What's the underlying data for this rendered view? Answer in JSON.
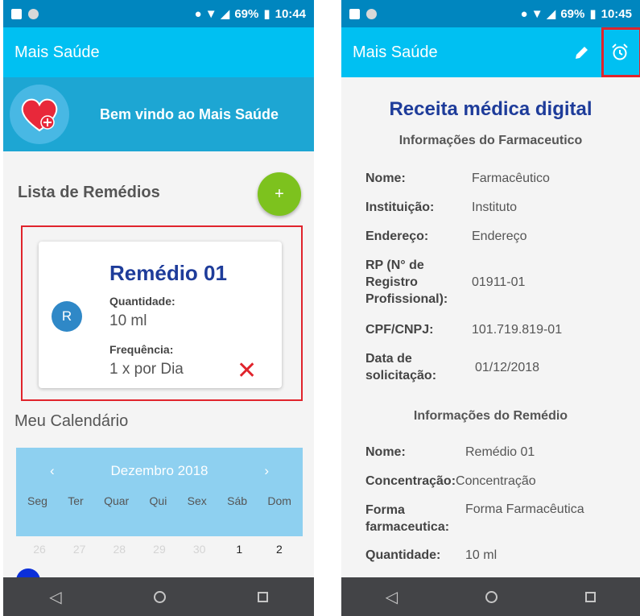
{
  "colors": {
    "status_bar": "#0086bf",
    "app_bar": "#00c0f2",
    "welcome_banner": "#1da6d3",
    "accent_blue": "#1e3c9a",
    "fab_green": "#7dc21e",
    "highlight_red": "#e0242c",
    "calendar_bg": "#8ed0f0",
    "nav_bar": "#434447"
  },
  "left": {
    "status": {
      "battery": "69%",
      "time": "10:44"
    },
    "app_title": "Mais Saúde",
    "welcome": "Bem vindo ao Mais Saúde",
    "list_title": "Lista de Remédios",
    "fab_label": "+",
    "card": {
      "avatar": "R",
      "name": "Remédio 01",
      "quantity_label": "Quantidade:",
      "quantity_value": "10 ml",
      "frequency_label": "Frequência:",
      "frequency_value": "1 x por Dia",
      "remove_icon": "✕"
    },
    "calendar_title": "Meu Calendário",
    "calendar": {
      "prev": "‹",
      "month": "Dezembro",
      "year": "2018",
      "next": "›",
      "weekdays": [
        "Seg",
        "Ter",
        "Quar",
        "Qui",
        "Sex",
        "Sáb",
        "Dom"
      ],
      "days": [
        "26",
        "27",
        "28",
        "29",
        "30",
        "1",
        "2"
      ]
    }
  },
  "right": {
    "status": {
      "battery": "69%",
      "time": "10:45"
    },
    "app_title": "Mais Saúde",
    "doc_title": "Receita médica digital",
    "pharmacist_header": "Informações do Farmaceutico",
    "pharmacist": [
      {
        "key": "Nome:",
        "value": "Farmacêutico"
      },
      {
        "key": "Instituição:",
        "value": "Instituto"
      },
      {
        "key": "Endereço:",
        "value": "Endereço"
      },
      {
        "key": "RP (N° de Registro Profissional):",
        "value": "01911-01"
      },
      {
        "key": "CPF/CNPJ:",
        "value": "101.719.819-01"
      },
      {
        "key": "Data de solicitação:",
        "value": "01/12/2018"
      }
    ],
    "medicine_header": "Informações do Remédio",
    "medicine": [
      {
        "key": "Nome:",
        "value": "Remédio 01"
      },
      {
        "key": "Concentração:",
        "value": "Concentração"
      },
      {
        "key": "Forma farmaceutica:",
        "value": "Forma Farmacêutica"
      },
      {
        "key": "Quantidade:",
        "value": "10 ml"
      }
    ]
  },
  "nav": {
    "back": "◁",
    "home": "○",
    "recents": "□"
  }
}
